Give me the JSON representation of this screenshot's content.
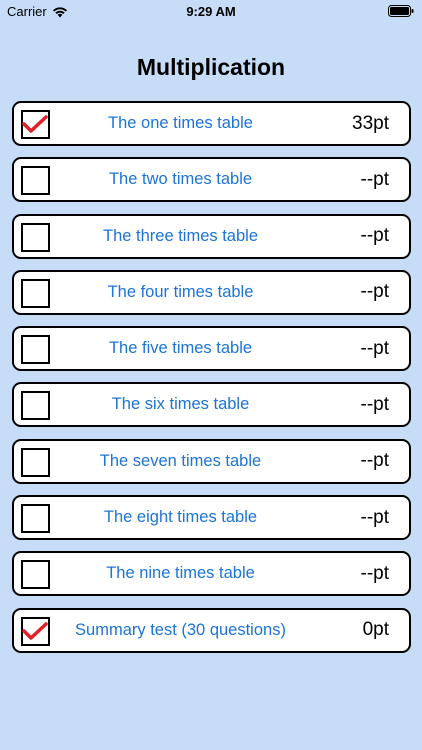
{
  "status_bar": {
    "carrier": "Carrier",
    "time": "9:29 AM",
    "wifi_icon": "wifi-icon",
    "battery_icon": "battery-icon"
  },
  "title": "Multiplication",
  "colors": {
    "background": "#c6dcf7",
    "label": "#1b74d6",
    "check": "#e0202a"
  },
  "rows": [
    {
      "label": "The one times table",
      "score": "33pt",
      "checked": true
    },
    {
      "label": "The two times table",
      "score": "--pt",
      "checked": false
    },
    {
      "label": "The three times table",
      "score": "--pt",
      "checked": false
    },
    {
      "label": "The four times table",
      "score": "--pt",
      "checked": false
    },
    {
      "label": "The five times table",
      "score": "--pt",
      "checked": false
    },
    {
      "label": "The six times table",
      "score": "--pt",
      "checked": false
    },
    {
      "label": "The seven times table",
      "score": "--pt",
      "checked": false
    },
    {
      "label": "The eight times table",
      "score": "--pt",
      "checked": false
    },
    {
      "label": "The nine times table",
      "score": "--pt",
      "checked": false
    },
    {
      "label": "Summary test (30 questions)",
      "score": "0pt",
      "checked": true
    }
  ]
}
